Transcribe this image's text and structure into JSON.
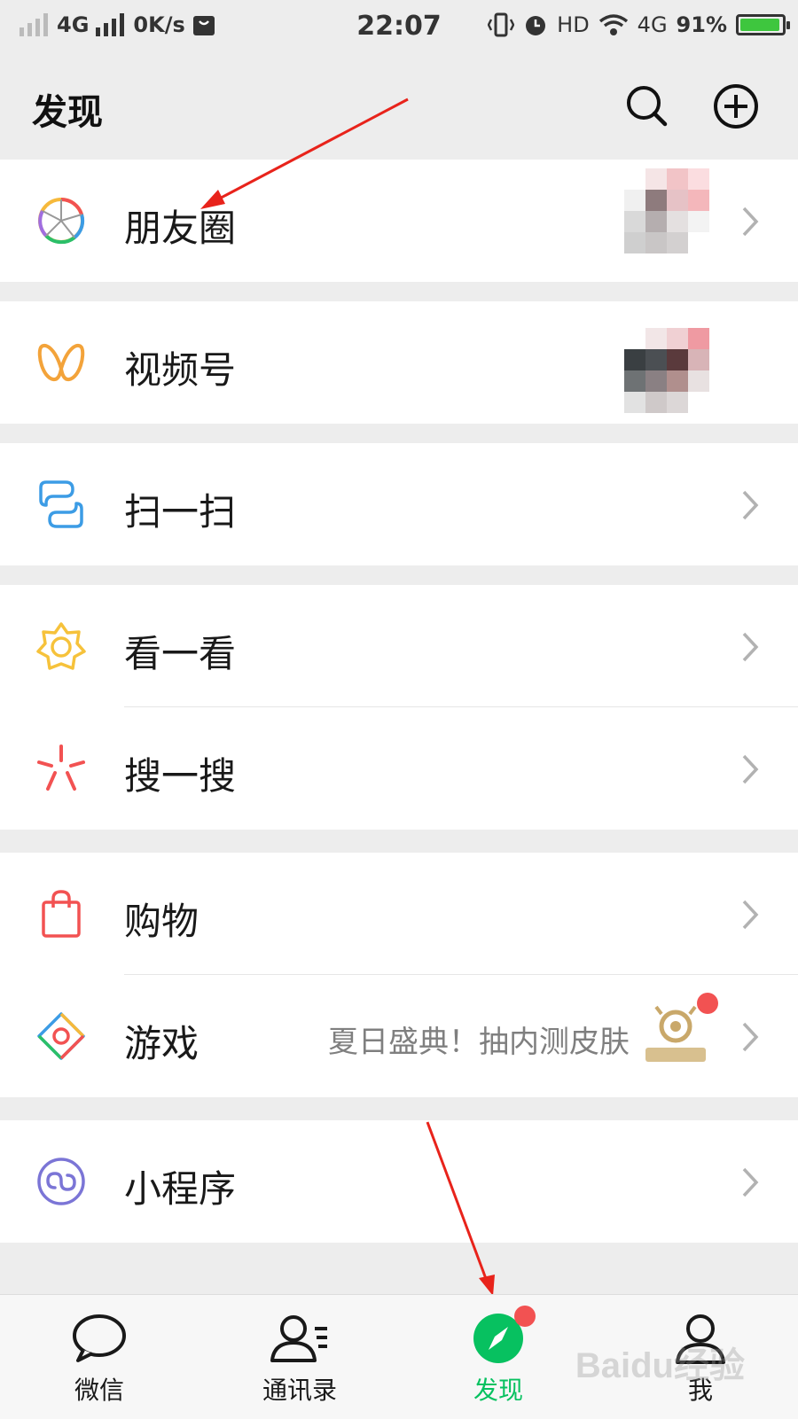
{
  "status_bar": {
    "network_left": "4G",
    "speed": "0K/s",
    "time": "22:07",
    "hd": "HD",
    "network_right": "4G",
    "battery": "91%"
  },
  "header": {
    "title": "发现"
  },
  "menu": {
    "moments": "朋友圈",
    "channels": "视频号",
    "scan": "扫一扫",
    "top_stories": "看一看",
    "search": "搜一搜",
    "shopping": "购物",
    "games": "游戏",
    "games_promo": "夏日盛典！抽内测皮肤",
    "mini_programs": "小程序"
  },
  "tabs": [
    {
      "label": "微信"
    },
    {
      "label": "通讯录"
    },
    {
      "label": "发现"
    },
    {
      "label": "我"
    }
  ],
  "colors": {
    "accent": "#07c160",
    "badge": "#f25252",
    "background": "#ededed"
  },
  "watermark": "Baidu经验"
}
